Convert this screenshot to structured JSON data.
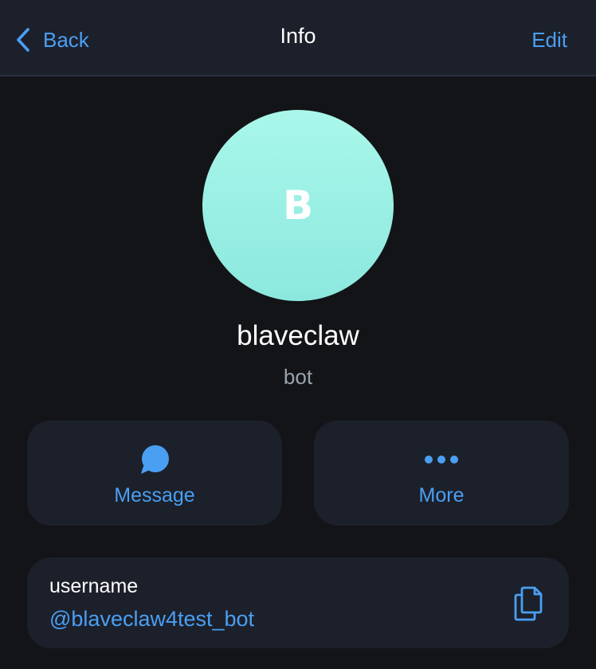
{
  "navbar": {
    "back_label": "Back",
    "title": "Info",
    "edit_label": "Edit"
  },
  "profile": {
    "avatar_letter": "B",
    "name": "blaveclaw",
    "status": "bot"
  },
  "actions": [
    {
      "label": "Message",
      "icon": "chat-bubble-icon"
    },
    {
      "label": "More",
      "icon": "more-dots-icon"
    }
  ],
  "info": {
    "label": "username",
    "value": "@blaveclaw4test_bot",
    "icon": "copy-icon"
  },
  "colors": {
    "accent": "#4a9ff3",
    "background": "#131417",
    "surface": "#1c202b",
    "avatar_top": "#a9f7ea",
    "avatar_bottom": "#8ce8de",
    "secondary_text": "#9aa3ad"
  }
}
